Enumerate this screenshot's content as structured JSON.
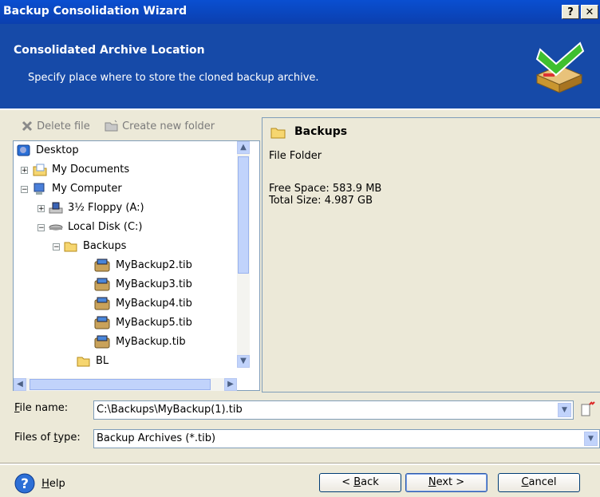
{
  "window": {
    "title": "Backup Consolidation Wizard",
    "help_btn": "?",
    "close_btn": "✕"
  },
  "header": {
    "title": "Consolidated Archive Location",
    "subtitle": "Specify place where to store the cloned backup archive."
  },
  "toolbar": {
    "delete_label": "Delete file",
    "new_folder_label": "Create new folder"
  },
  "tree": {
    "items": [
      {
        "label": "Desktop"
      },
      {
        "label": "My Documents"
      },
      {
        "label": "My Computer"
      },
      {
        "label": "3½ Floppy (A:)"
      },
      {
        "label": "Local Disk (C:)"
      },
      {
        "label": "Backups"
      },
      {
        "label": "MyBackup2.tib"
      },
      {
        "label": "MyBackup3.tib"
      },
      {
        "label": "MyBackup4.tib"
      },
      {
        "label": "MyBackup5.tib"
      },
      {
        "label": "MyBackup.tib"
      },
      {
        "label": "BL"
      }
    ]
  },
  "info": {
    "name": "Backups",
    "type": "File Folder",
    "free_space": "Free Space: 583.9 MB",
    "total_size": "Total Size: 4.987 GB"
  },
  "file_name": {
    "label_pre": "",
    "label_acc": "F",
    "label_post": "ile name:",
    "value": "C:\\Backups\\MyBackup(1).tib"
  },
  "file_type": {
    "label_pre": "Files of ",
    "label_acc": "t",
    "label_post": "ype:",
    "value": "Backup Archives (*.tib)"
  },
  "footer": {
    "help": {
      "acc": "H",
      "rest": "elp"
    },
    "back": {
      "pre": "< ",
      "acc": "B",
      "rest": "ack"
    },
    "next": {
      "acc": "N",
      "rest": "ext >"
    },
    "cancel": {
      "acc": "C",
      "rest": "ancel"
    }
  },
  "colors": {
    "title_bar": "#0b4bc9",
    "header_bg": "#164aa8",
    "dialog_bg": "#ece9d8"
  }
}
